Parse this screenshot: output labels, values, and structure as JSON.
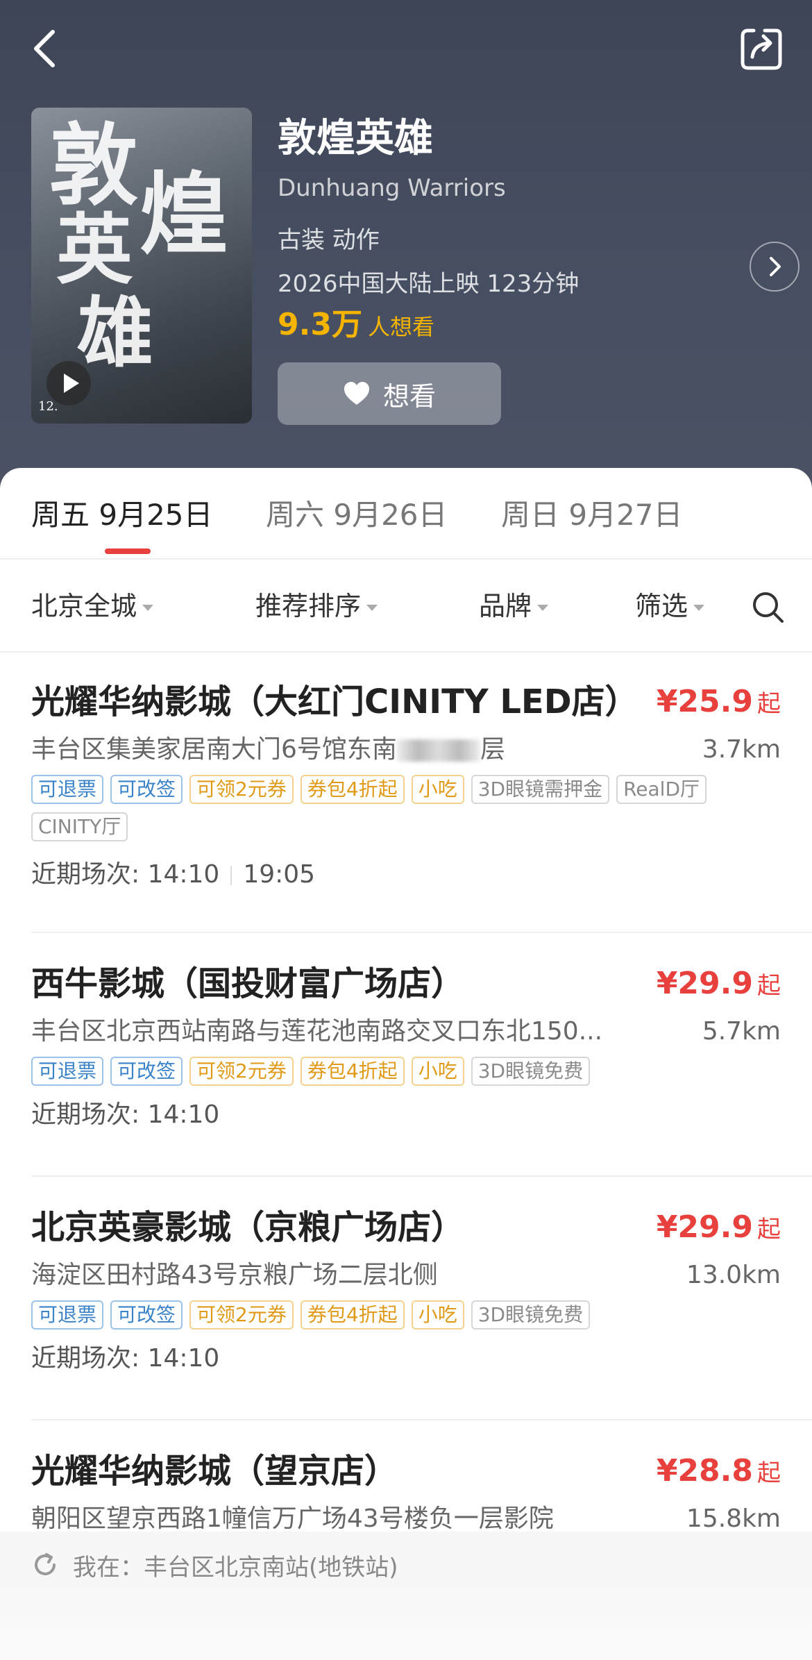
{
  "header": {
    "back_icon": "chevron-left-icon",
    "share_icon": "share-icon"
  },
  "movie": {
    "title": "敦煌英雄",
    "english_title": "Dunhuang Warriors",
    "genre": "古装 动作",
    "release": "2026中国大陆上映 123分钟",
    "wish_count": "9.3万",
    "wish_suffix": "人想看",
    "wish_button": "想看",
    "poster_chars": [
      "敦",
      "煌",
      "英",
      "雄"
    ],
    "poster_tag": "12.",
    "colors": {
      "accent": "#e8413d",
      "wish": "#f5b400",
      "header_bg": "#424a5c"
    }
  },
  "dates": [
    {
      "label": "周五 9月25日",
      "active": true
    },
    {
      "label": "周六 9月26日",
      "active": false
    },
    {
      "label": "周日 9月27日",
      "active": false
    }
  ],
  "filters": {
    "city": "北京全城",
    "sort": "推荐排序",
    "brand": "品牌",
    "filter": "筛选"
  },
  "cinemas": [
    {
      "name": "光耀华纳影城（大红门CINITY LED店）",
      "price": "¥25.9",
      "price_suffix": "起",
      "address_start": "丰台区集美家居南大门6号馆东南",
      "address_end": "层",
      "distance": "3.7km",
      "tags": [
        "可退票",
        "可改签",
        "可领2元券",
        "券包4折起",
        "小吃",
        "3D眼镜需押金",
        "RealD厅",
        "CINITY厅"
      ],
      "times_label": "近期场次: 14:10",
      "times_extra": "19:05"
    },
    {
      "name": "西牛影城（国投财富广场店）",
      "price": "¥29.9",
      "price_suffix": "起",
      "address": "丰台区北京西站南路与莲花池南路交叉口东北150...",
      "distance": "5.7km",
      "tags": [
        "可退票",
        "可改签",
        "可领2元券",
        "券包4折起",
        "小吃",
        "3D眼镜免费"
      ],
      "times_label": "近期场次: 14:10"
    },
    {
      "name": "北京英豪影城（京粮广场店）",
      "price": "¥29.9",
      "price_suffix": "起",
      "address": "海淀区田村路43号京粮广场二层北侧",
      "distance": "13.0km",
      "tags": [
        "可退票",
        "可改签",
        "可领2元券",
        "券包4折起",
        "小吃",
        "3D眼镜免费"
      ],
      "times_label": "近期场次: 14:10"
    },
    {
      "name": "光耀华纳影城（望京店）",
      "price": "¥28.8",
      "price_suffix": "起",
      "address": "朝阳区望京西路1幢信万广场43号楼负一层影院",
      "distance": "15.8km"
    }
  ],
  "location": {
    "text": "我在：丰台区北京南站(地铁站)"
  }
}
